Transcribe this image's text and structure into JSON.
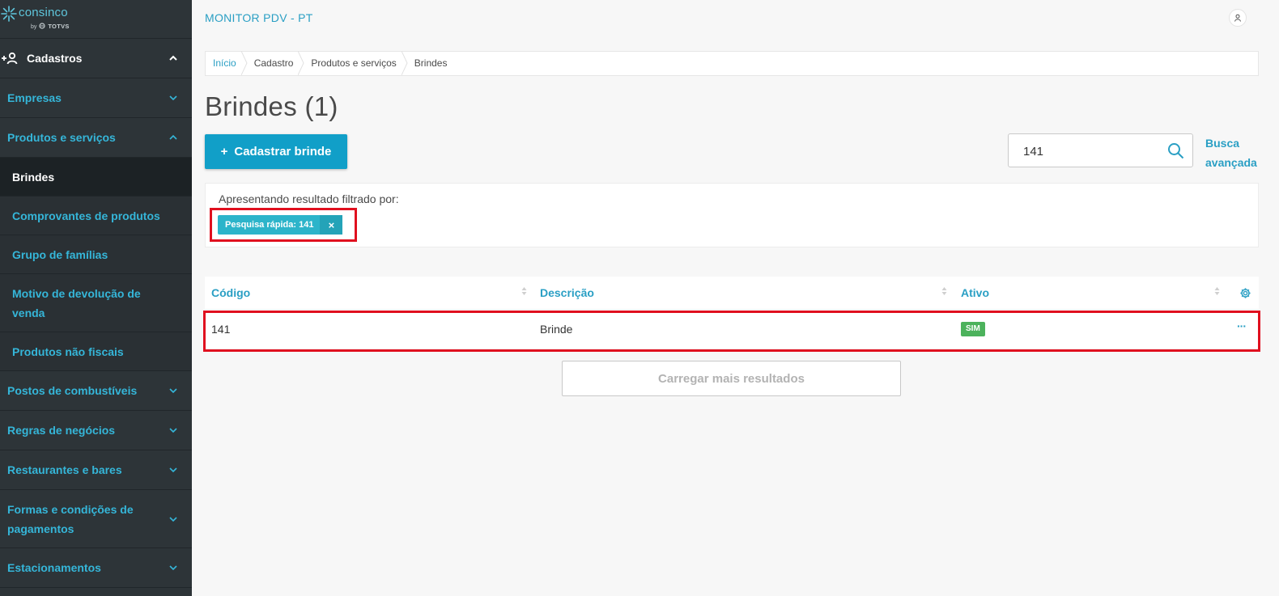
{
  "brand": {
    "name": "consinco",
    "sub_by": "by",
    "sub_brand": "TOTVS",
    "accent": "#5fc7dd"
  },
  "sidebar": {
    "section": {
      "label": "Cadastros",
      "expanded": true
    },
    "items": [
      {
        "label": "Empresas",
        "level": "top",
        "chevron": "down"
      },
      {
        "label": "Produtos e serviços",
        "level": "top",
        "chevron": "up"
      },
      {
        "label": "Brindes",
        "level": "sub",
        "active": true
      },
      {
        "label": "Comprovantes de produtos",
        "level": "sub"
      },
      {
        "label": "Grupo de famílias",
        "level": "sub"
      },
      {
        "label": "Motivo de devolução de venda",
        "level": "sub"
      },
      {
        "label": "Produtos não fiscais",
        "level": "sub"
      },
      {
        "label": "Postos de combustíveis",
        "level": "top",
        "chevron": "down"
      },
      {
        "label": "Regras de negócios",
        "level": "top",
        "chevron": "down"
      },
      {
        "label": "Restaurantes e bares",
        "level": "top",
        "chevron": "down"
      },
      {
        "label": "Formas e condições de pagamentos",
        "level": "top",
        "chevron": "down"
      },
      {
        "label": "Estacionamentos",
        "level": "top",
        "chevron": "down"
      }
    ]
  },
  "header": {
    "app_title": "MONITOR PDV - PT"
  },
  "breadcrumb": [
    "Início",
    "Cadastro",
    "Produtos e serviços",
    "Brindes"
  ],
  "page": {
    "title": "Brindes (1)",
    "add_button": "Cadastrar brinde",
    "search_value": "141",
    "advanced_search": "Busca avançada"
  },
  "filter": {
    "label": "Apresentando resultado filtrado por:",
    "chip": "Pesquisa rápida: 141",
    "chip_close": "×"
  },
  "table": {
    "columns": [
      "Código",
      "Descrição",
      "Ativo"
    ],
    "rows": [
      {
        "codigo": "141",
        "descricao": "Brinde",
        "ativo": "SIM",
        "menu": "···"
      }
    ]
  },
  "load_more": "Carregar mais resultados",
  "colors": {
    "primary": "#119fc8",
    "link": "#2a9fc4",
    "highlight": "#e0101f",
    "badge": "#4cb25c",
    "sidebar_bg": "#2d3438"
  }
}
